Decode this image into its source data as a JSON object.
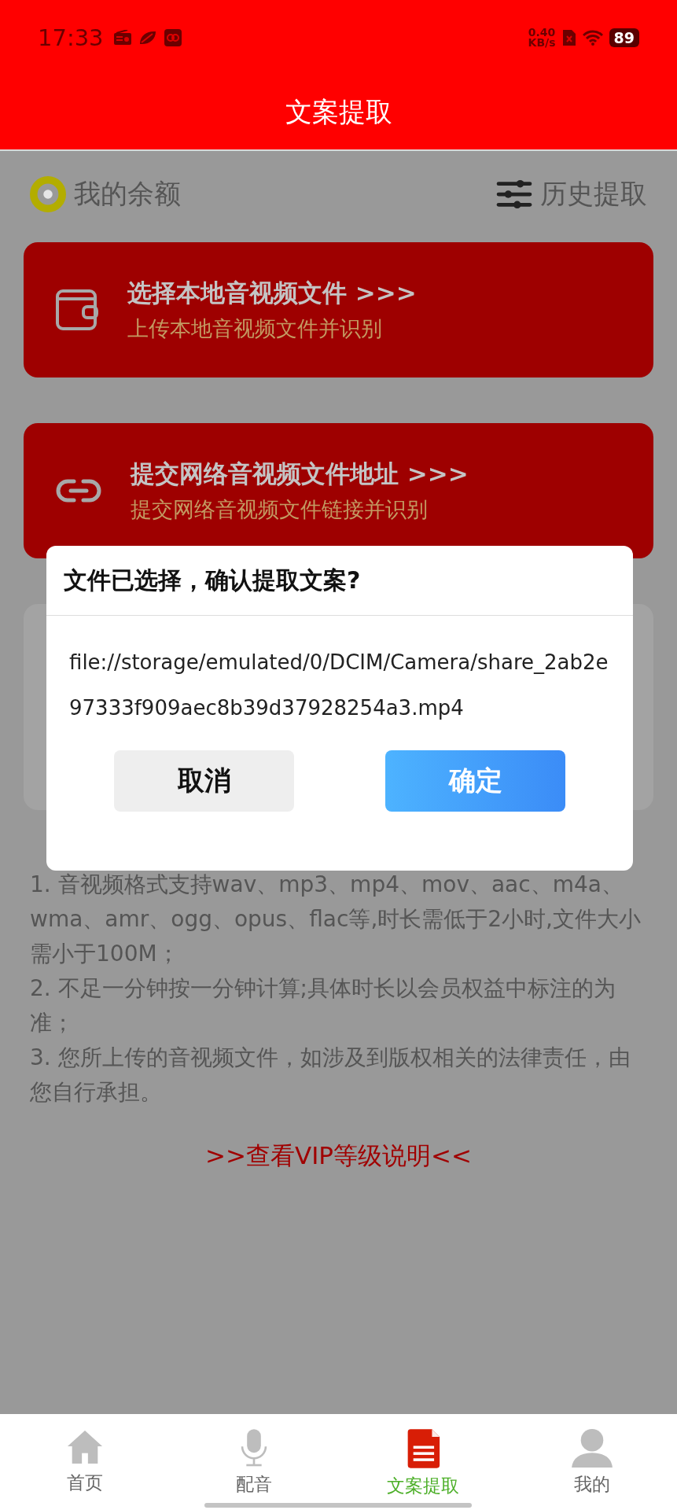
{
  "status_bar": {
    "time": "17:33",
    "net_speed": "0.40",
    "net_unit": "KB/s",
    "battery": "89"
  },
  "header": {
    "title": "文案提取"
  },
  "balance": {
    "label": "我的余额"
  },
  "history": {
    "label": "历史提取"
  },
  "actions": [
    {
      "kind": "file",
      "title": "选择本地音视频文件 >>>",
      "subtitle": "上传本地音视频文件并识别"
    },
    {
      "kind": "link",
      "title": "提交网络音视频文件地址 >>>",
      "subtitle": "提交网络音视频文件链接并识别"
    }
  ],
  "notes": [
    "1. 音视频格式支持wav、mp3、mp4、mov、aac、m4a、wma、amr、ogg、opus、flac等,时长需低于2小时,文件大小需小于100M；",
    "2. 不足一分钟按一分钟计算;具体时长以会员权益中标注的为准；",
    "3. 您所上传的音视频文件，如涉及到版权相关的法律责任，由您自行承担。"
  ],
  "vip_link": ">>查看VIP等级说明<<",
  "dialog": {
    "title": "文件已选择，确认提取文案?",
    "message": "file://storage/emulated/0/DCIM/Camera/share_2ab2e97333f909aec8b39d37928254a3.mp4",
    "buttons": [
      {
        "kind": "cancel",
        "label": "取消"
      },
      {
        "kind": "confirm",
        "label": "确定"
      }
    ]
  },
  "tabs": [
    {
      "kind": "home",
      "label": "首页",
      "selected": false
    },
    {
      "kind": "mic",
      "label": "配音",
      "selected": false
    },
    {
      "kind": "doc",
      "label": "文案提取",
      "selected": true
    },
    {
      "kind": "user",
      "label": "我的",
      "selected": false
    }
  ]
}
